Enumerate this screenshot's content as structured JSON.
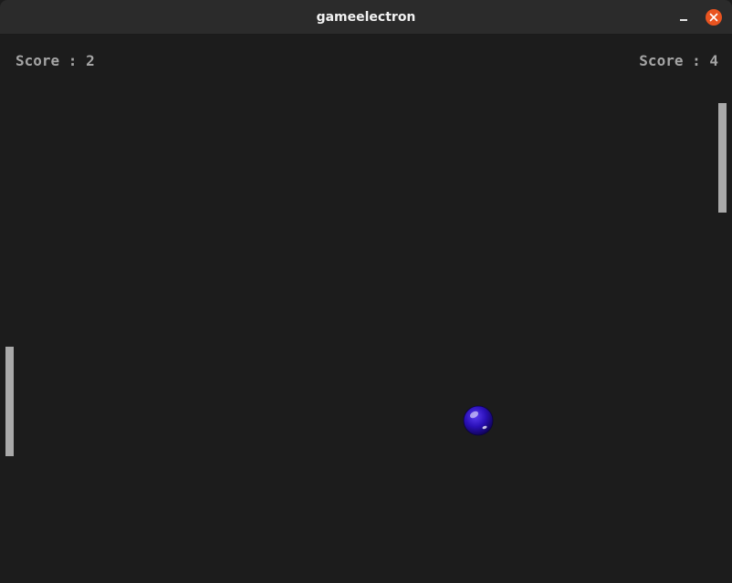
{
  "window": {
    "title": "gameelectron"
  },
  "game": {
    "left_score": "Score : 2",
    "right_score": "Score : 4"
  }
}
